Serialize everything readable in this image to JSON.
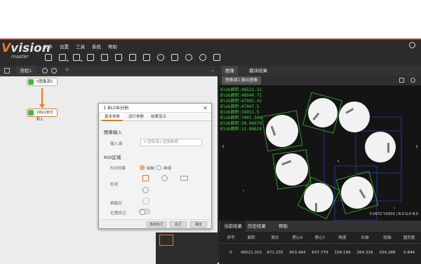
{
  "app": {
    "logo_main": "vision",
    "logo_sub": "master",
    "menu": [
      "文件",
      "设置",
      "工具",
      "系统",
      "帮助"
    ]
  },
  "flow": {
    "tab_label": "流程1",
    "nodes": [
      "0图像源1",
      "1BLOB分析1"
    ]
  },
  "dialog": {
    "title": "1 BLOB分析",
    "close": "✕",
    "tabs": [
      "基本参数",
      "运行参数",
      "结果显示"
    ],
    "section_image": "图像输入",
    "input_source_label": "输入源",
    "input_source_value": "0 图像源1.图像数据",
    "section_roi": "ROI区域",
    "roi_create_label": "ROI创建",
    "roi_option_draw": "绘制",
    "roi_option_inherit": "继承",
    "shape_label": "形状",
    "mask_label": "屏蔽区",
    "position_fix_label": "位置修正",
    "buttons": [
      "连续执行",
      "执行",
      "确定"
    ]
  },
  "right": {
    "tabs": [
      "图像",
      "模块结果"
    ],
    "subtab": "图像源1.输出图像",
    "blob_labels": [
      "Blob面积:48521.31",
      "Blob面积:48040.71",
      "Blob面积:47995.42",
      "Blob面积:47047.5",
      "Blob面积:34951.5",
      "Blob面积:7007.306",
      "Blob面积:38.96078",
      "Blob面积:11.88628"
    ],
    "coord_readout": "X:0972  Y:0433  |  R:0 G:0 B:0"
  },
  "results": {
    "tabs": [
      "当前结果",
      "历史结果",
      "帮助"
    ],
    "headers": [
      "序号",
      "面积",
      "周长",
      "质心X",
      "质心Y",
      "角度",
      "长轴",
      "短轴",
      "圆形度"
    ],
    "row": [
      "0",
      "48521.310",
      "871.235",
      "603.494",
      "637.779",
      "158.199",
      "264.316",
      "254.288",
      "0.844"
    ]
  },
  "colors": {
    "accent": "#e07a2b",
    "blob_label": "#3ed63e",
    "roi_box": "#2a3ca8",
    "bbox": "#35b835"
  }
}
